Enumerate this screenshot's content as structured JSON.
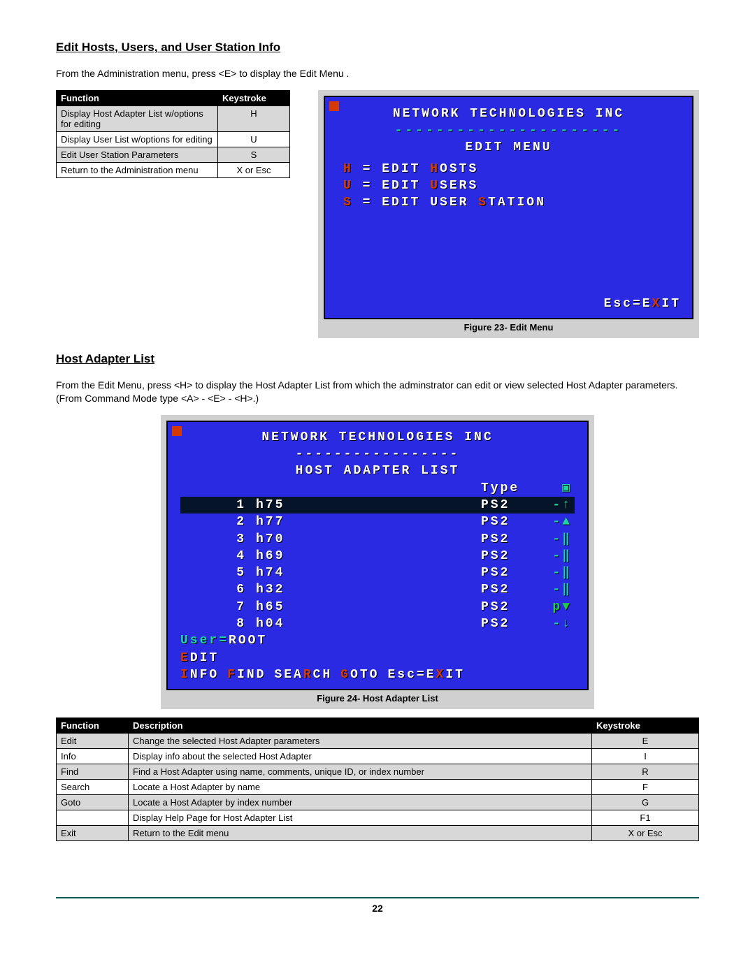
{
  "section1": {
    "heading": "Edit Hosts, Users, and User Station Info",
    "intro": "From the Administration menu, press <E> to display the Edit Menu ."
  },
  "table1": {
    "headers": [
      "Function",
      "Keystroke"
    ],
    "rows": [
      {
        "fn": "Display Host Adapter List w/options for editing",
        "key": "H",
        "shade": true
      },
      {
        "fn": "Display User List w/options for editing",
        "key": "U",
        "shade": false
      },
      {
        "fn": "Edit User Station Parameters",
        "key": "S",
        "shade": true
      },
      {
        "fn": "Return to the Administration menu",
        "key": "X  or  Esc",
        "shade": false
      }
    ]
  },
  "fig23": {
    "caption": "Figure 23- Edit Menu",
    "title": "NETWORK TECHNOLOGIES INC",
    "menutitle": "EDIT MENU",
    "lines": [
      {
        "key": "H",
        "rest1": " = EDIT ",
        "hot": "H",
        "rest2": "OSTS"
      },
      {
        "key": "U",
        "rest1": " = EDIT ",
        "hot": "U",
        "rest2": "SERS"
      },
      {
        "key": "S",
        "rest1": " = EDIT USER ",
        "hot": "S",
        "rest2": "TATION"
      }
    ],
    "footer_pre": "Esc=E",
    "footer_hot": "X",
    "footer_post": "IT"
  },
  "section2": {
    "heading": "Host Adapter List",
    "intro": "From the Edit Menu,  press <H> to display the Host Adapter List from which the adminstrator can edit or view selected Host Adapter parameters.  (From Command Mode type <A> - <E> - <H>.)"
  },
  "fig24": {
    "caption": "Figure 24- Host Adapter List",
    "title": "NETWORK TECHNOLOGIES INC",
    "subtitle": "HOST ADAPTER LIST",
    "type_label": "Type",
    "rows": [
      {
        "idx": "1",
        "name": "h75",
        "type": "PS2",
        "end": "-↑",
        "sel": true
      },
      {
        "idx": "2",
        "name": "h77",
        "type": "PS2",
        "end": "-▲",
        "sel": false
      },
      {
        "idx": "3",
        "name": "h70",
        "type": "PS2",
        "end": "-‖",
        "sel": false
      },
      {
        "idx": "4",
        "name": "h69",
        "type": "PS2",
        "end": "-‖",
        "sel": false
      },
      {
        "idx": "5",
        "name": "h74",
        "type": "PS2",
        "end": "-‖",
        "sel": false
      },
      {
        "idx": "6",
        "name": "h32",
        "type": "PS2",
        "end": "-‖",
        "sel": false
      },
      {
        "idx": "7",
        "name": "h65",
        "type": "PS2",
        "end": "p▼",
        "sel": false,
        "green_end": true
      },
      {
        "idx": "8",
        "name": "h04",
        "type": "PS2",
        "end": "-↓",
        "sel": false
      }
    ],
    "user_label": "User=",
    "user_value": "ROOT",
    "cmds": [
      {
        "hot": "E",
        "rest": "DIT"
      },
      {
        "hot": "I",
        "rest": "NFO"
      },
      {
        "hot": "F",
        "rest": "IND"
      },
      {
        "plain_pre": "SEA",
        "hot": "R",
        "rest": "CH"
      },
      {
        "hot": "G",
        "rest": "OTO"
      },
      {
        "plain_pre": "Esc=E",
        "hot": "X",
        "rest": "IT"
      }
    ]
  },
  "table2": {
    "headers": [
      "Function",
      "Description",
      "Keystroke"
    ],
    "rows": [
      {
        "fn": "Edit",
        "desc": "Change the selected Host Adapter parameters",
        "key": "E",
        "shade": true
      },
      {
        "fn": "Info",
        "desc": "Display info about the selected Host Adapter",
        "key": "I",
        "shade": false
      },
      {
        "fn": "Find",
        "desc": "Find a Host Adapter using name, comments, unique ID, or index number",
        "key": "R",
        "shade": true
      },
      {
        "fn": "Search",
        "desc": "Locate a Host Adapter by name",
        "key": "F",
        "shade": false
      },
      {
        "fn": "Goto",
        "desc": "Locate a Host Adapter by index number",
        "key": "G",
        "shade": true
      },
      {
        "fn": "",
        "desc": "Display Help Page for Host Adapter List",
        "key": "F1",
        "shade": false
      },
      {
        "fn": "Exit",
        "desc": "Return to the Edit menu",
        "key": "X  or  Esc",
        "shade": true
      }
    ]
  },
  "page_number": "22"
}
